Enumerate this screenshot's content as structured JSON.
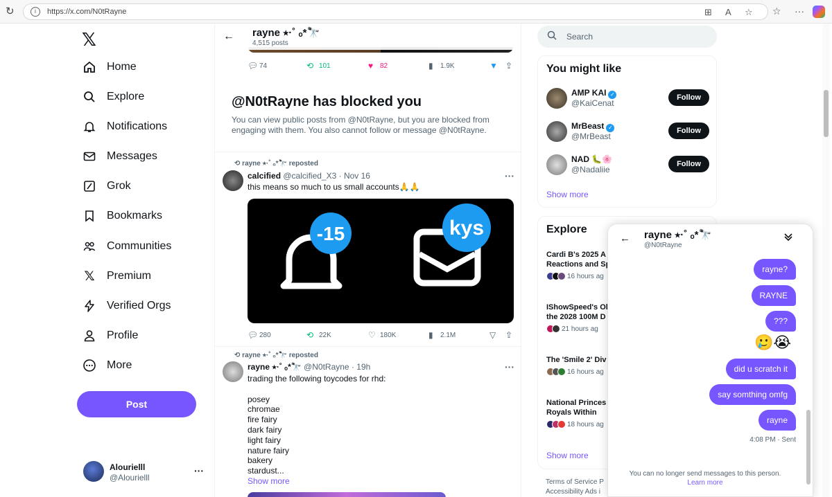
{
  "browser": {
    "url": "https://x.com/N0tRayne"
  },
  "nav": {
    "items": [
      {
        "label": "Home",
        "icon": "home-icon"
      },
      {
        "label": "Explore",
        "icon": "search-icon"
      },
      {
        "label": "Notifications",
        "icon": "bell-icon"
      },
      {
        "label": "Messages",
        "icon": "envelope-icon"
      },
      {
        "label": "Grok",
        "icon": "grok-icon"
      },
      {
        "label": "Bookmarks",
        "icon": "bookmark-icon"
      },
      {
        "label": "Communities",
        "icon": "communities-icon"
      },
      {
        "label": "Premium",
        "icon": "x-logo-icon"
      },
      {
        "label": "Verified Orgs",
        "icon": "lightning-icon"
      },
      {
        "label": "Profile",
        "icon": "person-icon"
      },
      {
        "label": "More",
        "icon": "more-circle-icon"
      }
    ],
    "post_label": "Post",
    "account": {
      "name": "Alourielll",
      "handle": "@Alourielll"
    }
  },
  "profile_header": {
    "name": "rayne ⭑·˚ ₒ*🔭",
    "posts": "4,515 posts"
  },
  "top_actions": {
    "replies": "74",
    "reposts": "101",
    "likes": "82",
    "views": "1.9K"
  },
  "blocked": {
    "title": "@N0tRayne has blocked you",
    "body": "You can view public posts from @N0tRayne, but you are blocked from engaging with them. You also cannot follow or message @N0tRayne."
  },
  "tweets": [
    {
      "repost_label": "rayne ⭑·˚ ₒ*🔭 reposted",
      "name": "calcified",
      "handle": "@calcified_X3",
      "time": "· Nov 16",
      "text": "this means so much to us small accounts🙏🙏",
      "media": {
        "badge1": "-15",
        "badge2": "kys"
      },
      "actions": {
        "replies": "280",
        "reposts": "22K",
        "likes": "180K",
        "views": "2.1M"
      }
    },
    {
      "repost_label": "rayne ⭑·˚ ₒ*🔭 reposted",
      "name": "rayne ⭑·˚ ₒ*🔭",
      "handle": "@N0tRayne",
      "time": "· 19h",
      "lines": [
        "trading the following toycodes for rhd:",
        "",
        "posey",
        "chromae",
        "fire fairy",
        "dark fairy",
        "light fairy",
        "nature fairy",
        "bakery",
        "stardust..."
      ],
      "show_more": "Show more"
    }
  ],
  "search": {
    "placeholder": "Search"
  },
  "might_like": {
    "title": "You might like",
    "follow_label": "Follow",
    "users": [
      {
        "name": "AMP KAI",
        "handle": "@KaiCenat",
        "verified": true
      },
      {
        "name": "MrBeast",
        "handle": "@MrBeast",
        "verified": true
      },
      {
        "name": "NAD 🐛🌸",
        "handle": "@Nadaliie",
        "verified": false
      }
    ],
    "show_more": "Show more"
  },
  "explore": {
    "title": "Explore",
    "trends": [
      {
        "title": "Cardi B's 2025 A",
        "title2": "Reactions and Sp",
        "meta": "16 hours ag"
      },
      {
        "title": "IShowSpeed's Ol",
        "title2": "the 2028 100M D",
        "meta": "21 hours ag"
      },
      {
        "title": "The 'Smile 2' Div",
        "title2": "",
        "meta": "16 hours ag"
      },
      {
        "title": "National Princes",
        "title2": "Royals Within",
        "meta": "18 hours ag"
      }
    ],
    "show_more": "Show more"
  },
  "footer": {
    "line1": "Terms of Service  P",
    "line2": "Accessibility  Ads i"
  },
  "dm": {
    "name": "rayne ⭑·˚ ₒ*🔭",
    "handle": "@N0tRayne",
    "messages": [
      "rayne?",
      "RAYNE",
      "???",
      "did u scratch it",
      "say somthing omfg",
      "rayne"
    ],
    "emojis": "🥲😭",
    "status": "4:08 PM · Sent",
    "note": "You can no longer send messages to this person.",
    "learn_more": "Learn more"
  },
  "colors": {
    "accent": "#7856ff",
    "text": "#0f1419",
    "muted": "#536471",
    "like": "#f91880",
    "repost": "#00ba7c"
  }
}
